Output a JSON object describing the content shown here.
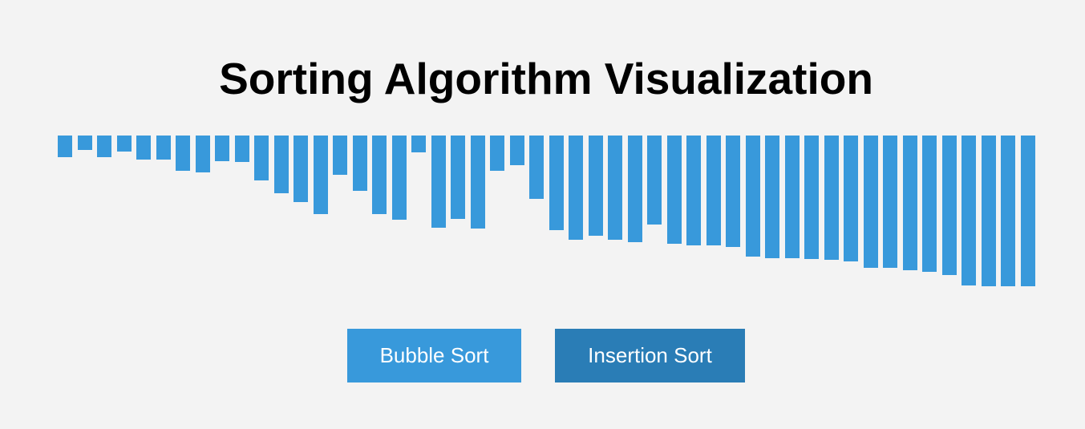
{
  "page": {
    "title": "Sorting Algorithm Visualization"
  },
  "buttons": {
    "bubble_sort_label": "Bubble Sort",
    "insertion_sort_label": "Insertion Sort"
  },
  "colors": {
    "background": "#f3f3f3",
    "bar": "#3899db",
    "bubble_button": "#3899db",
    "insertion_button": "#2a7db6"
  },
  "chart_data": {
    "type": "bar",
    "values": [
      27,
      18,
      27,
      20,
      30,
      30,
      44,
      46,
      32,
      33,
      56,
      72,
      83,
      98,
      49,
      69,
      98,
      105,
      21,
      115,
      104,
      116,
      44,
      37,
      79,
      118,
      130,
      125,
      130,
      133,
      111,
      135,
      137,
      137,
      139,
      151,
      153,
      153,
      154,
      155,
      157,
      165,
      165,
      168,
      170,
      174,
      187,
      188,
      188,
      188
    ],
    "ylim": [
      0,
      200
    ],
    "title": "",
    "xlabel": "",
    "ylabel": ""
  }
}
